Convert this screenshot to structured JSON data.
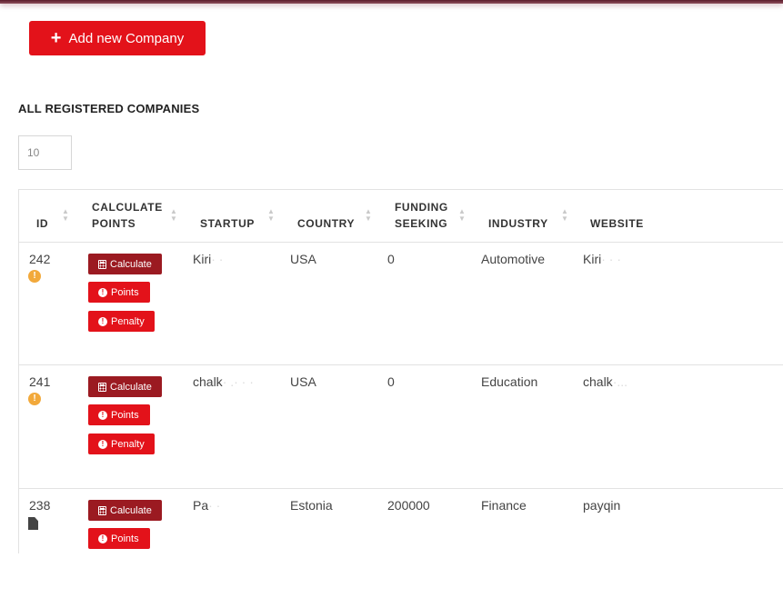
{
  "actions": {
    "add_company_label": "Add new Company"
  },
  "section": {
    "title": "ALL REGISTERED COMPANIES",
    "page_size": "10"
  },
  "table": {
    "headers": {
      "id": "ID",
      "calc_line1": "CALCULATE",
      "calc_line2": "POINTS",
      "startup": "STARTUP",
      "country": "COUNTRY",
      "funding_line1": "FUNDING",
      "funding_line2": "SEEKING",
      "industry": "INDUSTRY",
      "website": "WEBSITE"
    },
    "button_labels": {
      "calculate": "Calculate",
      "points": "Points",
      "penalty": "Penalty"
    },
    "rows": [
      {
        "id": "242",
        "startup_visible": "Kiri",
        "startup_blurred": "·  ·",
        "country": "USA",
        "funding": "0",
        "industry": "Automotive",
        "website_visible": "Kiri",
        "website_blurred": "·  · ·"
      },
      {
        "id": "241",
        "startup_visible": "chalk",
        "startup_blurred": "· .·  ·  ·",
        "country": "USA",
        "funding": "0",
        "industry": "Education",
        "website_visible": "chalk",
        "website_blurred": "·..."
      },
      {
        "id": "238",
        "startup_visible": "Pa",
        "startup_blurred": "·  ·",
        "country": "Estonia",
        "funding": "200000",
        "industry": "Finance",
        "website_visible": "payqin",
        "website_blurred": ""
      }
    ]
  }
}
